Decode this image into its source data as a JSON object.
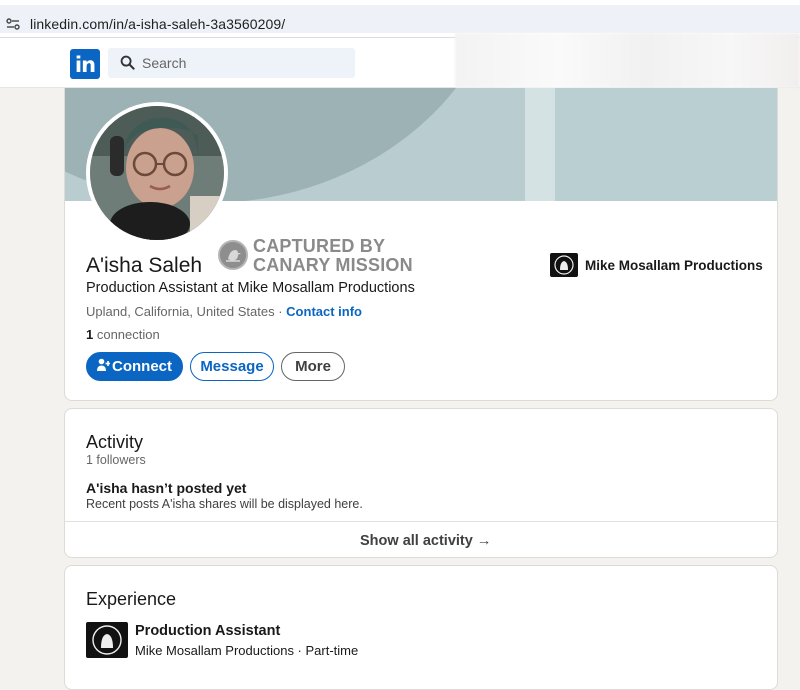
{
  "browser": {
    "url": "linkedin.com/in/a-isha-saleh-3a3560209/"
  },
  "nav": {
    "logo_text": "in",
    "search_placeholder": "Search"
  },
  "profile": {
    "name": "A'isha Saleh",
    "stamp_line1": "CAPTURED BY",
    "stamp_line2": "CANARY MISSION",
    "headline": "Production Assistant at Mike Mosallam Productions",
    "location": "Upland, California, United States",
    "location_sep": " · ",
    "contact_info": "Contact info",
    "connection_count": "1",
    "connection_label": " connection",
    "current_company": "Mike Mosallam Productions",
    "buttons": {
      "connect": "Connect",
      "message": "Message",
      "more": "More"
    }
  },
  "activity": {
    "title": "Activity",
    "followers": "1 followers",
    "empty_title": "A'isha hasn’t posted yet",
    "empty_subtitle": "Recent posts A'isha shares will be displayed here.",
    "show_all": "Show all activity →"
  },
  "experience": {
    "title": "Experience",
    "items": [
      {
        "role": "Production Assistant",
        "company_line": "Mike Mosallam Productions · Part-time"
      }
    ]
  },
  "colors": {
    "linkedin_blue": "#0a66c2",
    "page_bg": "#f4f2ee",
    "banner": "#b9cdd0"
  },
  "icons": [
    "tune-icon",
    "linkedin-logo-icon",
    "search-icon",
    "canary-mission-stamp-icon",
    "add-person-icon",
    "arrow-right-icon",
    "company-logo-icon"
  ]
}
